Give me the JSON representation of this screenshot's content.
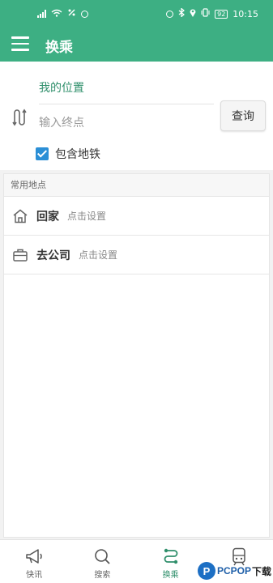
{
  "status_bar": {
    "time": "10:15",
    "battery": "92"
  },
  "app_bar": {
    "title": "换乘",
    "menu_icon": "menu-icon"
  },
  "search": {
    "origin": "我的位置",
    "destination_placeholder": "输入终点",
    "destination_value": "",
    "query_button": "查询",
    "include_subway_label": "包含地铁",
    "include_subway_checked": true
  },
  "frequent_places": {
    "header": "常用地点",
    "items": [
      {
        "name": "回家",
        "hint": "点击设置",
        "icon": "home-icon"
      },
      {
        "name": "去公司",
        "hint": "点击设置",
        "icon": "briefcase-icon"
      }
    ]
  },
  "bottom_nav": {
    "items": [
      {
        "label": "快讯",
        "icon": "megaphone-icon",
        "active": false
      },
      {
        "label": "搜索",
        "icon": "search-icon",
        "active": false
      },
      {
        "label": "换乘",
        "icon": "transfer-icon",
        "active": true
      },
      {
        "label": "",
        "icon": "train-icon",
        "active": false
      }
    ]
  },
  "watermark": {
    "letter": "P",
    "brand": "PCPOP",
    "suffix": "下载"
  },
  "colors": {
    "primary": "#3daf83",
    "checkbox": "#2b8fd6"
  }
}
